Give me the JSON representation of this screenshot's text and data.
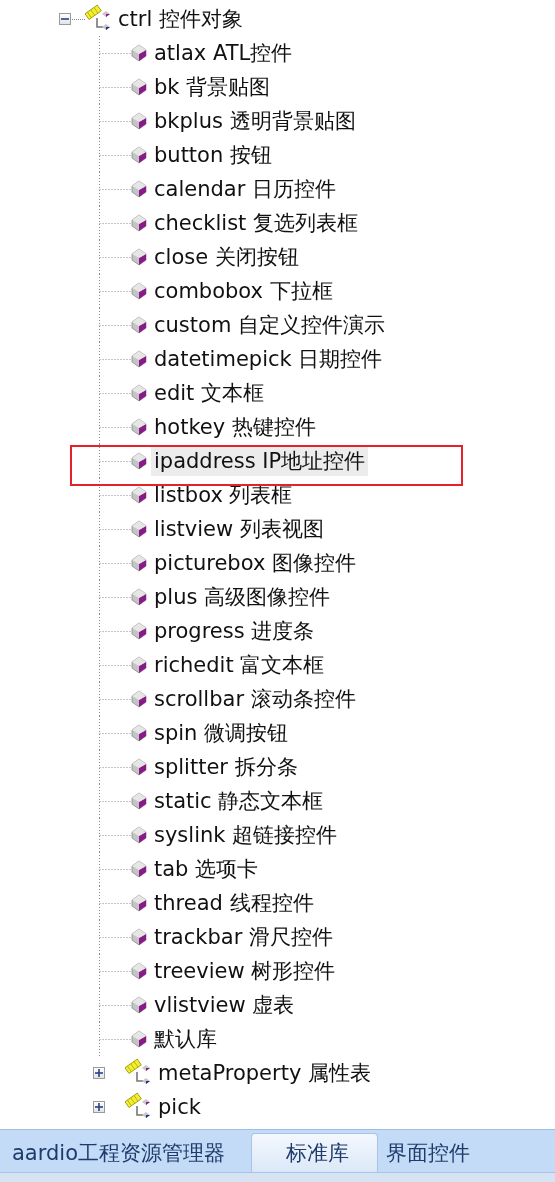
{
  "tree": [
    {
      "kind": "namespace",
      "label": "ctrl 控件对象",
      "expanded": true,
      "selected": false,
      "marked": false,
      "children": [
        {
          "kind": "leaf",
          "label": "atlax ATL控件",
          "selected": false,
          "marked": false
        },
        {
          "kind": "leaf",
          "label": "bk 背景贴图",
          "selected": false,
          "marked": false
        },
        {
          "kind": "leaf",
          "label": "bkplus 透明背景贴图",
          "selected": false,
          "marked": false
        },
        {
          "kind": "leaf",
          "label": "button 按钮",
          "selected": false,
          "marked": false
        },
        {
          "kind": "leaf",
          "label": "calendar 日历控件",
          "selected": false,
          "marked": false
        },
        {
          "kind": "leaf",
          "label": "checklist 复选列表框",
          "selected": false,
          "marked": false
        },
        {
          "kind": "leaf",
          "label": "close 关闭按钮",
          "selected": false,
          "marked": false
        },
        {
          "kind": "leaf",
          "label": "combobox 下拉框",
          "selected": false,
          "marked": false
        },
        {
          "kind": "leaf",
          "label": "custom 自定义控件演示",
          "selected": false,
          "marked": false
        },
        {
          "kind": "leaf",
          "label": "datetimepick 日期控件",
          "selected": false,
          "marked": false
        },
        {
          "kind": "leaf",
          "label": "edit 文本框",
          "selected": false,
          "marked": false
        },
        {
          "kind": "leaf",
          "label": "hotkey 热键控件",
          "selected": false,
          "marked": false
        },
        {
          "kind": "leaf",
          "label": "ipaddress IP地址控件",
          "selected": true,
          "marked": true
        },
        {
          "kind": "leaf",
          "label": "listbox 列表框",
          "selected": false,
          "marked": false
        },
        {
          "kind": "leaf",
          "label": "listview 列表视图",
          "selected": false,
          "marked": false
        },
        {
          "kind": "leaf",
          "label": "picturebox 图像控件",
          "selected": false,
          "marked": false
        },
        {
          "kind": "leaf",
          "label": "plus 高级图像控件",
          "selected": false,
          "marked": false
        },
        {
          "kind": "leaf",
          "label": "progress 进度条",
          "selected": false,
          "marked": false
        },
        {
          "kind": "leaf",
          "label": "richedit 富文本框",
          "selected": false,
          "marked": false
        },
        {
          "kind": "leaf",
          "label": "scrollbar 滚动条控件",
          "selected": false,
          "marked": false
        },
        {
          "kind": "leaf",
          "label": "spin 微调按钮",
          "selected": false,
          "marked": false
        },
        {
          "kind": "leaf",
          "label": "splitter 拆分条",
          "selected": false,
          "marked": false
        },
        {
          "kind": "leaf",
          "label": "static 静态文本框",
          "selected": false,
          "marked": false
        },
        {
          "kind": "leaf",
          "label": "syslink 超链接控件",
          "selected": false,
          "marked": false
        },
        {
          "kind": "leaf",
          "label": "tab 选项卡",
          "selected": false,
          "marked": false
        },
        {
          "kind": "leaf",
          "label": "thread 线程控件",
          "selected": false,
          "marked": false
        },
        {
          "kind": "leaf",
          "label": "trackbar 滑尺控件",
          "selected": false,
          "marked": false
        },
        {
          "kind": "leaf",
          "label": "treeview 树形控件",
          "selected": false,
          "marked": false
        },
        {
          "kind": "leaf",
          "label": "vlistview 虚表",
          "selected": false,
          "marked": false
        },
        {
          "kind": "leaf",
          "label": "默认库",
          "selected": false,
          "marked": false
        },
        {
          "kind": "namespace",
          "label": "metaProperty 属性表",
          "expanded": false,
          "selected": false,
          "marked": false
        },
        {
          "kind": "namespace",
          "label": "pick",
          "expanded": false,
          "selected": false,
          "marked": false
        }
      ]
    }
  ],
  "tabs": [
    {
      "label": "aardio工程资源管理器",
      "selected": false
    },
    {
      "label": "标准库",
      "selected": true
    },
    {
      "label": "界面控件",
      "selected": false
    }
  ]
}
